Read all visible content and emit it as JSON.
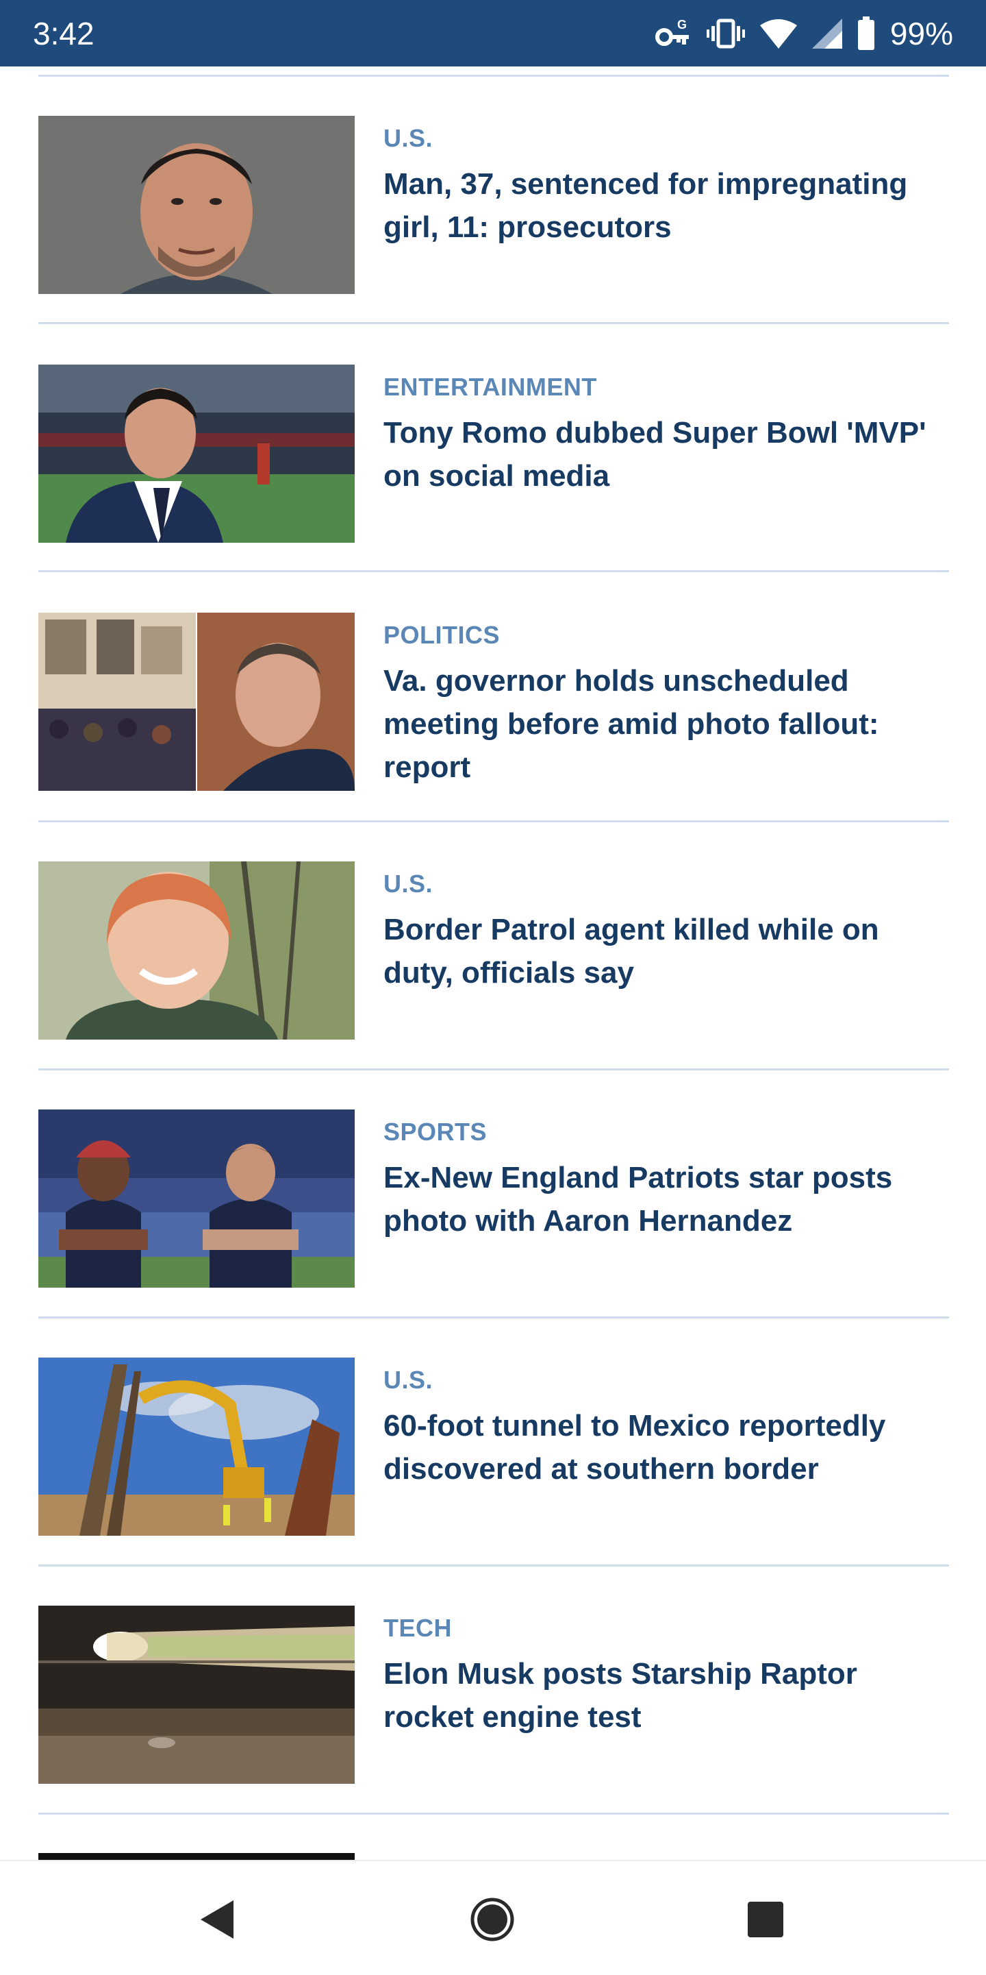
{
  "status_bar": {
    "time": "3:42",
    "battery": "99%",
    "icons": [
      "vpn-key-icon",
      "vibrate-icon",
      "wifi-icon",
      "signal-icon",
      "battery-icon"
    ]
  },
  "articles": [
    {
      "category": "U.S.",
      "headline": "Man, 37, sentenced for impregnating girl, 11: prosecutors"
    },
    {
      "category": "ENTERTAINMENT",
      "headline": "Tony Romo dubbed Super Bowl 'MVP' on social media"
    },
    {
      "category": "POLITICS",
      "headline": "Va. governor holds unscheduled meeting before amid photo fallout: report"
    },
    {
      "category": "U.S.",
      "headline": "Border Patrol agent killed while on duty, officials say"
    },
    {
      "category": "SPORTS",
      "headline": "Ex-New England Patriots star posts photo with Aaron Hernandez"
    },
    {
      "category": "U.S.",
      "headline": "60-foot tunnel to Mexico reportedly discovered at southern border"
    },
    {
      "category": "TECH",
      "headline": "Elon Musk posts Starship Raptor rocket engine test"
    }
  ],
  "colors": {
    "status_bar": "#1e4a7c",
    "category": "#5b87b6",
    "headline": "#173a63",
    "divider": "#cfdceb"
  },
  "navigation": {
    "back": "back-icon",
    "home": "home-icon",
    "recents": "recents-icon"
  }
}
